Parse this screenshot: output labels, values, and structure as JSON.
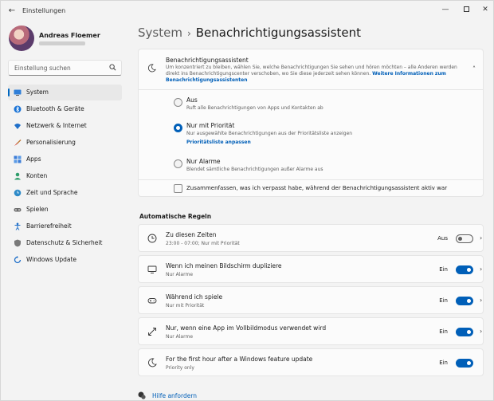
{
  "window": {
    "title": "Einstellungen",
    "back_glyph": "←",
    "minimize_glyph": "—",
    "close_glyph": "✕"
  },
  "user": {
    "name": "Andreas Floemer"
  },
  "search": {
    "placeholder": "Einstellung suchen"
  },
  "sidebar": {
    "items": [
      {
        "label": "System",
        "icon": "monitor-icon",
        "active": true
      },
      {
        "label": "Bluetooth & Geräte",
        "icon": "bluetooth-icon"
      },
      {
        "label": "Netzwerk & Internet",
        "icon": "wifi-icon"
      },
      {
        "label": "Personalisierung",
        "icon": "brush-icon"
      },
      {
        "label": "Apps",
        "icon": "apps-grid-icon"
      },
      {
        "label": "Konten",
        "icon": "account-icon"
      },
      {
        "label": "Zeit und Sprache",
        "icon": "globe-clock-icon"
      },
      {
        "label": "Spielen",
        "icon": "gamepad-icon"
      },
      {
        "label": "Barrierefreiheit",
        "icon": "accessibility-icon"
      },
      {
        "label": "Datenschutz & Sicherheit",
        "icon": "shield-icon"
      },
      {
        "label": "Windows Update",
        "icon": "update-icon"
      }
    ]
  },
  "breadcrumb": {
    "parent": "System",
    "separator": "›",
    "current": "Benachrichtigungsassistent"
  },
  "focus_card": {
    "title": "Benachrichtigungsassistent",
    "description": "Um konzentriert zu bleiben, wählen Sie, welche Benachrichtigungen Sie sehen und hören möchten – alle Anderen werden direkt ins Benachrichtigungscenter verschoben, wo Sie diese jederzeit sehen können.",
    "link": "Weitere Informationen zum Benachrichtigungsassistenten",
    "chevron": "˄",
    "options": [
      {
        "label": "Aus",
        "description": "Ruft alle Benachrichtigungen von Apps und Kontakten ab",
        "checked": false
      },
      {
        "label": "Nur mit Priorität",
        "description": "Nur ausgewählte Benachrichtigungen aus der Prioritätsliste anzeigen",
        "link": "Prioritätsliste anpassen",
        "checked": true
      },
      {
        "label": "Nur Alarme",
        "description": "Blendet sämtliche Benachrichtigungen außer Alarme aus",
        "checked": false
      }
    ],
    "summary_checkbox": {
      "label": "Zusammenfassen, was ich verpasst habe, während der Benachrichtigungsassistent aktiv war",
      "checked": false
    }
  },
  "rules_section": {
    "title": "Automatische Regeln",
    "rules": [
      {
        "title": "Zu diesen Zeiten",
        "subtitle": "23:00 - 07:00; Nur mit Priorität",
        "state": "Aus",
        "on": false,
        "icon": "clock-icon"
      },
      {
        "title": "Wenn ich meinen Bildschirm dupliziere",
        "subtitle": "Nur Alarme",
        "state": "Ein",
        "on": true,
        "icon": "display-icon"
      },
      {
        "title": "Während ich spiele",
        "subtitle": "Nur mit Priorität",
        "state": "Ein",
        "on": true,
        "icon": "gamepad-icon"
      },
      {
        "title": "Nur, wenn eine App im Vollbildmodus verwendet wird",
        "subtitle": "Nur Alarme",
        "state": "Ein",
        "on": true,
        "icon": "fullscreen-icon"
      },
      {
        "title": "For the first hour after a Windows feature update",
        "subtitle": "Priority only",
        "state": "Ein",
        "on": true,
        "icon": "moon-icon"
      }
    ],
    "chevron": "›"
  },
  "help": {
    "label": "Hilfe anfordern"
  },
  "colors": {
    "accent": "#005fb8",
    "background": "#f3f3f3",
    "card": "#fbfbfb"
  }
}
